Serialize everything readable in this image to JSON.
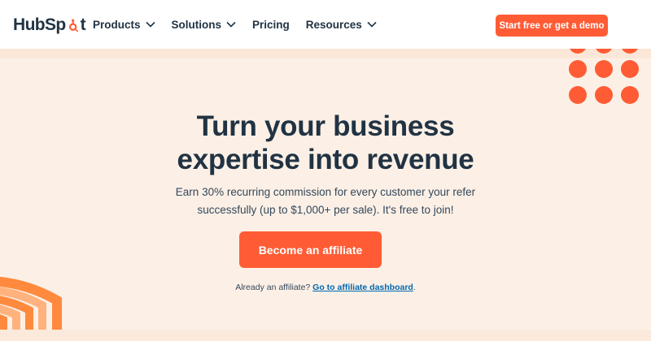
{
  "header": {
    "logo_part1": "HubSp",
    "logo_part2": "t",
    "nav": [
      {
        "label": "Products",
        "has_dropdown": true
      },
      {
        "label": "Solutions",
        "has_dropdown": true
      },
      {
        "label": "Pricing",
        "has_dropdown": false
      },
      {
        "label": "Resources",
        "has_dropdown": true
      }
    ],
    "cta_label": "Start free or get a demo"
  },
  "hero": {
    "headline_line1": "Turn your business",
    "headline_line2": "expertise into revenue",
    "subtext_line1": "Earn 30% recurring commission for every customer your refer",
    "subtext_line2": "successfully (up to $1,000+ per sale). It's free to join!",
    "cta_label": "Become an affiliate",
    "already_text": "Already an affiliate? ",
    "already_link": "Go to affiliate dashboard",
    "already_suffix": "."
  },
  "colors": {
    "brand_orange": "#ff5c35",
    "navy": "#213343",
    "hero_bg": "#fcf0e6",
    "link": "#0068b1",
    "arch_light": "#ffb27d",
    "arch_dark": "#ff8a3d"
  },
  "icons": {
    "logo": "hubspot-sprocket-icon",
    "dropdown": "chevron-down-icon"
  }
}
